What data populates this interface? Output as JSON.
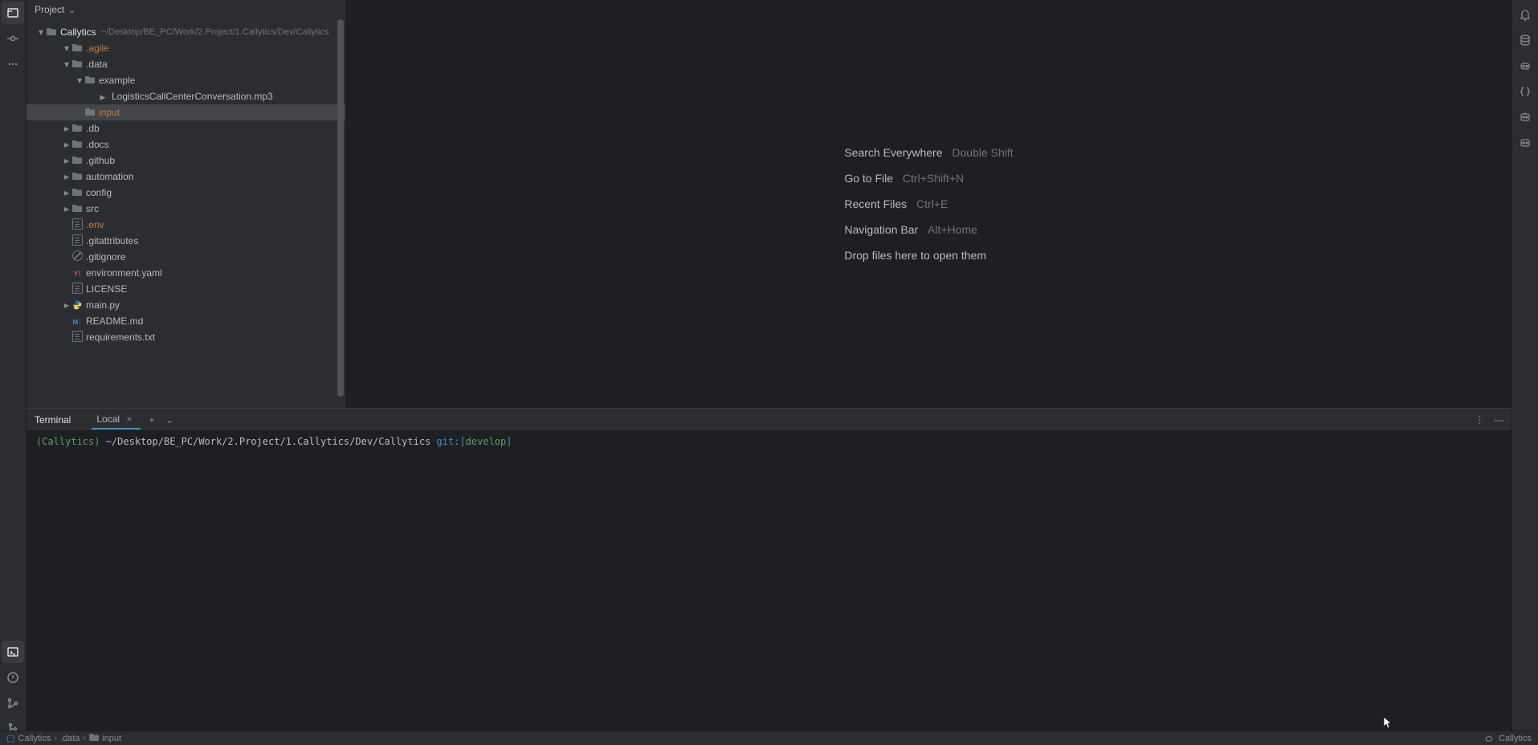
{
  "projectHeader": {
    "label": "Project"
  },
  "tree": {
    "root": {
      "name": "Callytics",
      "path": "~/Desktop/BE_PC/Work/2.Project/1.Callytics/Dev/Callytics"
    },
    "items": [
      {
        "indent": 2,
        "arrow": "▾",
        "icon": "folder",
        "name": ".agile",
        "orange": true
      },
      {
        "indent": 2,
        "arrow": "▾",
        "icon": "folder",
        "name": ".data"
      },
      {
        "indent": 3,
        "arrow": "▾",
        "icon": "folder",
        "name": "example"
      },
      {
        "indent": 4,
        "arrow": "",
        "icon": "mp3",
        "name": "LogisticsCallCenterConversation.mp3"
      },
      {
        "indent": 3,
        "arrow": "",
        "icon": "folder",
        "name": "input",
        "orange": true,
        "selected": true
      },
      {
        "indent": 2,
        "arrow": "▸",
        "icon": "folder",
        "name": ".db"
      },
      {
        "indent": 2,
        "arrow": "▸",
        "icon": "folder",
        "name": ".docs"
      },
      {
        "indent": 2,
        "arrow": "▸",
        "icon": "folder",
        "name": ".github"
      },
      {
        "indent": 2,
        "arrow": "▸",
        "icon": "folder",
        "name": "automation"
      },
      {
        "indent": 2,
        "arrow": "▸",
        "icon": "folder",
        "name": "config"
      },
      {
        "indent": 2,
        "arrow": "▸",
        "icon": "folder",
        "name": "src"
      },
      {
        "indent": 2,
        "arrow": "",
        "icon": "lines",
        "name": ".env",
        "orange": true
      },
      {
        "indent": 2,
        "arrow": "",
        "icon": "lines",
        "name": ".gitattributes"
      },
      {
        "indent": 2,
        "arrow": "",
        "icon": "gitign",
        "name": ".gitignore"
      },
      {
        "indent": 2,
        "arrow": "",
        "icon": "yaml",
        "name": "environment.yaml"
      },
      {
        "indent": 2,
        "arrow": "",
        "icon": "lines",
        "name": "LICENSE"
      },
      {
        "indent": 2,
        "arrow": "▸",
        "icon": "py",
        "name": "main.py"
      },
      {
        "indent": 2,
        "arrow": "",
        "icon": "md",
        "name": "README.md"
      },
      {
        "indent": 2,
        "arrow": "",
        "icon": "lines",
        "name": "requirements.txt"
      }
    ]
  },
  "welcome": {
    "searchEverywhere": {
      "label": "Search Everywhere",
      "shortcut": "Double Shift"
    },
    "goToFile": {
      "label": "Go to File",
      "shortcut": "Ctrl+Shift+N"
    },
    "recentFiles": {
      "label": "Recent Files",
      "shortcut": "Ctrl+E"
    },
    "navBar": {
      "label": "Navigation Bar",
      "shortcut": "Alt+Home"
    },
    "dropFiles": "Drop files here to open them"
  },
  "terminal": {
    "title": "Terminal",
    "tab": "Local",
    "prompt": {
      "env": "(Callytics)",
      "path": "~/Desktop/BE_PC/Work/2.Project/1.Callytics/Dev/Callytics",
      "gitLabel": "git:",
      "branchOpen": "[",
      "branch": "develop",
      "branchClose": "]"
    }
  },
  "breadcrumb": {
    "b0": "Callytics",
    "b1": ".data",
    "b2": "input"
  },
  "statusRight": {
    "interpreter": "Callytics"
  }
}
